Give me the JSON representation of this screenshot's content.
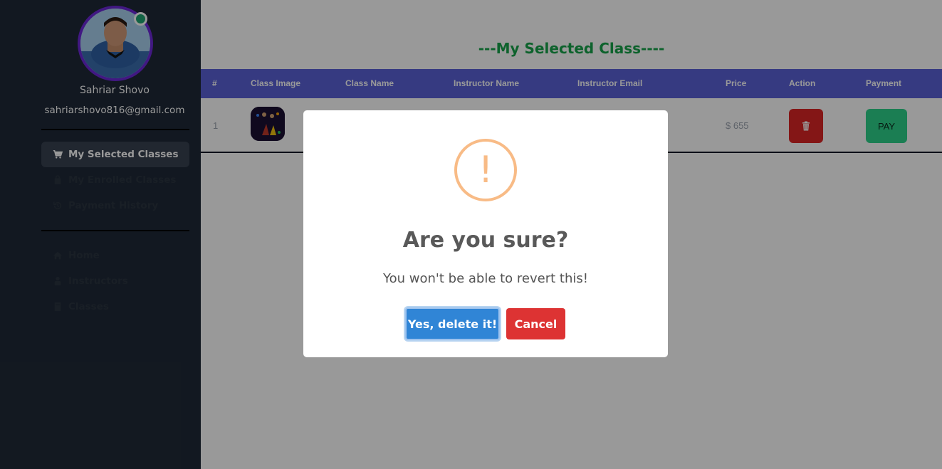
{
  "sidebar": {
    "user_name": "Sahriar Shovo",
    "user_email": "sahriarshovo816@gmail.com",
    "items": [
      {
        "label": "My Selected Classes",
        "icon": "cart-icon",
        "active": true
      },
      {
        "label": "My Enrolled Classes",
        "icon": "bag-icon",
        "active": false
      },
      {
        "label": "Payment History",
        "icon": "history-icon",
        "active": false
      }
    ],
    "secondary_items": [
      {
        "label": "Home",
        "icon": "home-icon"
      },
      {
        "label": "Instructors",
        "icon": "instructor-icon"
      },
      {
        "label": "Classes",
        "icon": "book-icon"
      }
    ]
  },
  "main": {
    "title": "---My Selected Class----",
    "table": {
      "headers": [
        "#",
        "Class Image",
        "Class Name",
        "Instructor Name",
        "Instructor Email",
        "Price",
        "Action",
        "Payment"
      ],
      "rows": [
        {
          "index": "1",
          "price": "$ 655",
          "pay_label": "PAY"
        }
      ]
    }
  },
  "modal": {
    "icon": "!",
    "title": "Are you sure?",
    "text": "You won't be able to revert this!",
    "confirm_label": "Yes, delete it!",
    "cancel_label": "Cancel"
  },
  "colors": {
    "sidebar_bg": "#1f2937",
    "table_header": "#5b62d8",
    "title_green": "#16a34a",
    "delete_red": "#dc2626",
    "pay_green": "#2dd28a",
    "confirm_blue": "#3085d6",
    "cancel_red": "#dd3333",
    "warning": "#f8bb86"
  }
}
